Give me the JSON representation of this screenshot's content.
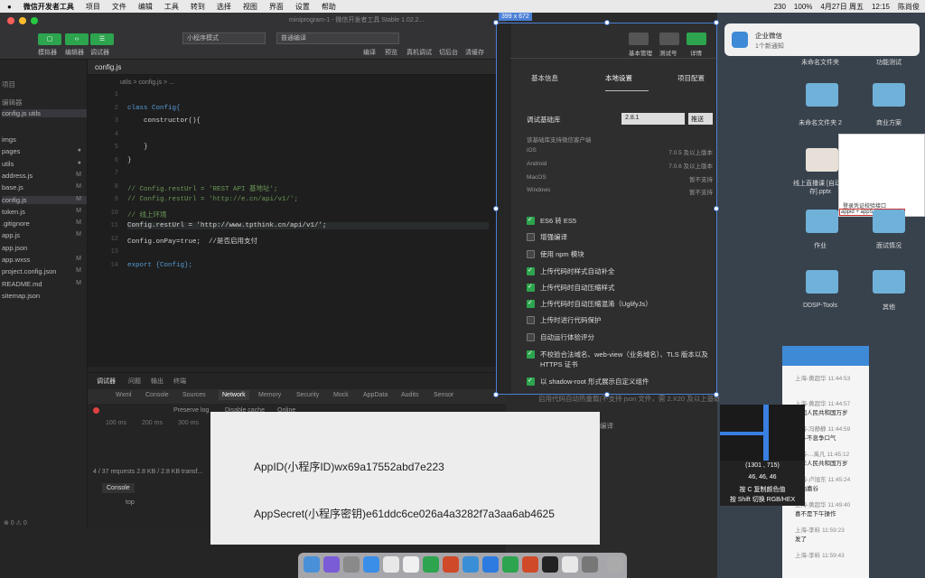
{
  "menubar": {
    "apple": "",
    "items": [
      "微信开发者工具",
      "项目",
      "文件",
      "编辑",
      "工具",
      "转到",
      "选择",
      "视图",
      "界面",
      "设置",
      "帮助"
    ],
    "status": [
      "230",
      "100%",
      "4月27日 周五",
      "12:15",
      "陈尚俊"
    ]
  },
  "window": {
    "title": "miniprogram-1 - 微信开发者工具 Stable 1.02.2...",
    "size_badge": "399 x 672"
  },
  "toolbar": {
    "simulator": "模拟器",
    "editor": "编辑器",
    "debugger": "调试器",
    "mode_select": "小程序模式",
    "compile_select": "普通编译",
    "actions": [
      "编译",
      "预览",
      "真机调试",
      "切后台",
      "清缓存"
    ]
  },
  "sidebar": {
    "section1": "项目",
    "section2": "编辑器",
    "open_file": "config.js  utils",
    "files": [
      {
        "name": "imgs",
        "mark": ""
      },
      {
        "name": "pages",
        "mark": "●"
      },
      {
        "name": "utils",
        "mark": "●"
      },
      {
        "name": "address.js",
        "mark": "M"
      },
      {
        "name": "base.js",
        "mark": "M"
      },
      {
        "name": "config.js",
        "mark": "M"
      },
      {
        "name": "token.js",
        "mark": "M"
      },
      {
        "name": ".gitignore",
        "mark": "M"
      },
      {
        "name": "app.js",
        "mark": "M"
      },
      {
        "name": "app.json",
        "mark": ""
      },
      {
        "name": "app.wxss",
        "mark": "M"
      },
      {
        "name": "project.config.json",
        "mark": "M"
      },
      {
        "name": "README.md",
        "mark": "M"
      },
      {
        "name": "sitemap.json",
        "mark": ""
      }
    ]
  },
  "editor": {
    "tab": "config.js",
    "breadcrumb": "utils  >  config.js  >  ...",
    "lines": [
      {
        "n": "1",
        "t": ""
      },
      {
        "n": "2",
        "t": "class Config{"
      },
      {
        "n": "3",
        "t": "    constructor(){"
      },
      {
        "n": "4",
        "t": ""
      },
      {
        "n": "5",
        "t": "    }"
      },
      {
        "n": "6",
        "t": "}"
      },
      {
        "n": "7",
        "t": ""
      },
      {
        "n": "8",
        "t": "// Config.restUrl = 'REST API 基地址';"
      },
      {
        "n": "9",
        "t": "// Config.restUrl = 'http://e.cn/api/v1/';"
      },
      {
        "n": "10",
        "t": "// 线上环境"
      },
      {
        "n": "11",
        "t": "Config.restUrl = 'http://www.tpthink.cn/api/v1/';"
      },
      {
        "n": "12",
        "t": "Config.onPay=true;  //是否启用支付"
      },
      {
        "n": "13",
        "t": ""
      },
      {
        "n": "14",
        "t": "export {Config};"
      }
    ]
  },
  "devtools": {
    "top_tabs": [
      "调试器",
      "问题",
      "输出",
      "终端"
    ],
    "tabs": [
      "Wxml",
      "Console",
      "Sources",
      "Network",
      "Memory",
      "Security",
      "Mock",
      "AppData",
      "Audits",
      "Sensor"
    ],
    "filters": [
      "Preserve log",
      "Disable cache",
      "Online"
    ],
    "timeline": [
      "100 ms",
      "200 ms",
      "300 ms"
    ],
    "requests": "4 / 37 requests   2.8 KB / 2.8 KB transf...",
    "console_tab": "Console",
    "console_ctx": "top"
  },
  "statusbar": {
    "errors": "⊗ 0 ⚠ 0"
  },
  "simulator": {
    "head_buttons": [
      "基本管理",
      "测试号",
      "详情"
    ],
    "tabs": [
      "基本信息",
      "本地设置",
      "项目配置"
    ],
    "lib_label": "调试基础库",
    "lib_version": "2.8.1",
    "push_button": "推送",
    "lib_note": "该基础库支持微信客户端",
    "platforms": [
      {
        "os": "iOS",
        "ver": "7.0.5 及以上版本"
      },
      {
        "os": "Android",
        "ver": "7.0.6 及以上版本"
      },
      {
        "os": "MacOS",
        "ver": "暂不支持"
      },
      {
        "os": "Windows",
        "ver": "暂不支持"
      }
    ],
    "options": [
      {
        "label": "ES6 转 ES5",
        "on": true
      },
      {
        "label": "增强编译",
        "on": false
      },
      {
        "label": "使用 npm 模块",
        "on": false
      },
      {
        "label": "上传代码时样式自动补全",
        "on": true
      },
      {
        "label": "上传代码时自动压缩样式",
        "on": true
      },
      {
        "label": "上传代码时自动压缩混淆（UglifyJs）",
        "on": true
      },
      {
        "label": "上传时进行代码保护",
        "on": false
      },
      {
        "label": "自动运行体验评分",
        "on": false
      },
      {
        "label": "不校验合法域名、web-view（业务域名）、TLS 版本以及 HTTPS 证书",
        "on": true
      },
      {
        "label": "以 shadow-root 形式展示自定义组件",
        "on": true
      }
    ],
    "below_text": "启用代码自动热重载(不支持 json 文件，需 2.X20 及以上基础库版本)",
    "below_compile": "编译"
  },
  "popup": {
    "appid": "AppID(小程序ID)wx69a17552abd7e223",
    "secret": "AppSecret(小程序密钥)e61ddc6ce026a4a3282f7a3aa6ab4625"
  },
  "notification": {
    "app": "企业微信",
    "text": "1个新通知"
  },
  "desktop": {
    "icons": [
      "未命名文件夹",
      "功能测试",
      "未命名文件夹 2",
      "商业方案",
      "线上直播课 [自动保存].pptx",
      "作业",
      "面试情况",
      "DDSP-Tools",
      "其他"
    ],
    "note": "登录凭证校验接口",
    "note2": "appid + appSecret + code"
  },
  "chat": {
    "messages": [
      {
        "who": "上海-黄超华 11:44:53",
        "text": ""
      },
      {
        "who": "上海-黄超华 11:44:57",
        "text": "中国人民共和国万岁"
      },
      {
        "who": "上海-冯静静 11:44:59",
        "text": "奋斗不息争口气"
      },
      {
        "who": "上海-...禹凡 11:45:12",
        "text": "中华人民共和国万岁"
      },
      {
        "who": "上海-卢旭东 11:45:24",
        "text": "加油嘉谷"
      },
      {
        "who": "上海-黄超华 11:49:40",
        "text": "喜不是下午操作"
      },
      {
        "who": "上海-李料 11:59:23",
        "text": "发了"
      },
      {
        "who": "上海-李料 11:59:43",
        "text": ""
      }
    ]
  },
  "zoom": {
    "coords": "(1301 , 715)",
    "rgb": "46, 46, 46",
    "hint1": "按 C 复制颜色值",
    "hint2": "按 Shift 切换 RGB/HEX"
  },
  "colors": {
    "accent": "#2da44e",
    "selection": "#4a7fd6",
    "editor_bg": "#1e1e1e"
  }
}
